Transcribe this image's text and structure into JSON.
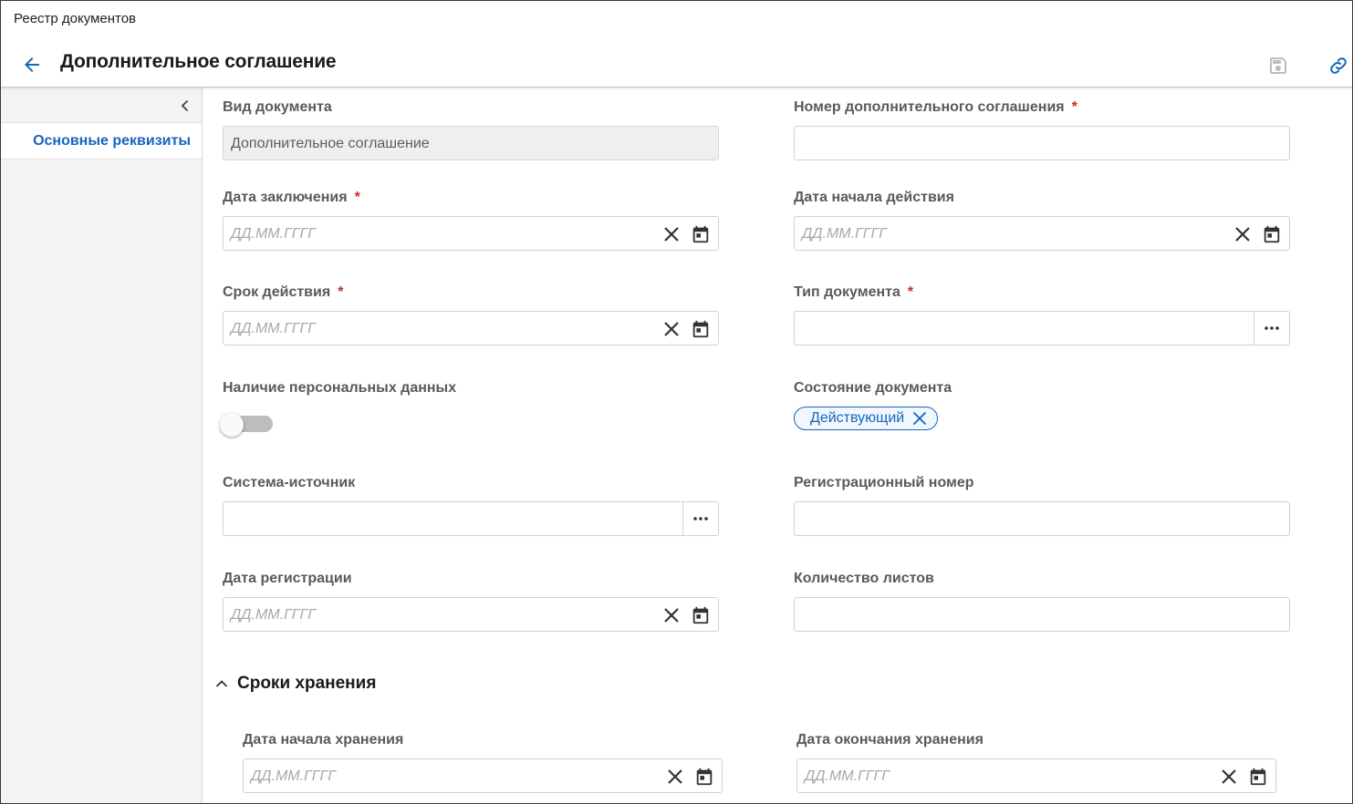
{
  "app": {
    "title": "Реестр документов"
  },
  "header": {
    "title": "Дополнительное соглашение"
  },
  "icons": {
    "back": "arrow-left-icon",
    "save": "floppy-disk-icon",
    "link": "link-icon",
    "collapse": "chevron-left-icon",
    "clear": "close-icon",
    "calendar": "calendar-icon",
    "more": "ellipsis-icon",
    "section": "chevron-up-icon"
  },
  "colors": {
    "accent": "#1565c0",
    "required": "#c62828",
    "sidebar_bg": "#f3f3f3",
    "readonly_bg": "#efefef"
  },
  "sidebar": {
    "items": [
      {
        "label": "Основные реквизиты",
        "active": true
      }
    ]
  },
  "form": {
    "doc_type": {
      "label": "Вид документа",
      "value": "Дополнительное соглашение"
    },
    "agreement_number": {
      "label": "Номер дополнительного соглашения",
      "required": "*",
      "value": ""
    },
    "conclusion_date": {
      "label": "Дата заключения",
      "required": "*",
      "placeholder": "ДД.ММ.ГГГГ"
    },
    "start_date": {
      "label": "Дата начала действия",
      "placeholder": "ДД.ММ.ГГГГ"
    },
    "validity": {
      "label": "Срок действия",
      "required": "*",
      "placeholder": "ДД.ММ.ГГГГ"
    },
    "document_type": {
      "label": "Тип документа",
      "required": "*",
      "value": ""
    },
    "personal_data": {
      "label": "Наличие персональных данных",
      "checked": false
    },
    "status": {
      "label": "Состояние документа",
      "chip": "Действующий"
    },
    "source_system": {
      "label": "Система-источник",
      "value": ""
    },
    "reg_number": {
      "label": "Регистрационный номер",
      "value": ""
    },
    "reg_date": {
      "label": "Дата регистрации",
      "placeholder": "ДД.ММ.ГГГГ"
    },
    "sheet_count": {
      "label": "Количество листов",
      "value": ""
    }
  },
  "storage": {
    "title": "Сроки хранения",
    "expanded": true,
    "start": {
      "label": "Дата начала хранения",
      "placeholder": "ДД.ММ.ГГГГ"
    },
    "end": {
      "label": "Дата окончания хранения",
      "placeholder": "ДД.ММ.ГГГГ"
    }
  }
}
